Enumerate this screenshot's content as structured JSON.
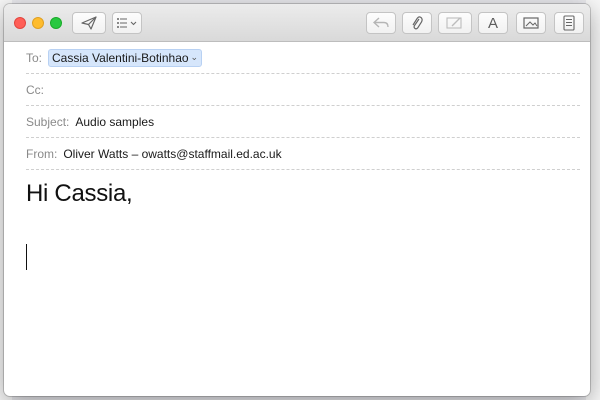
{
  "window": {
    "toolbar": {
      "send_icon": "paper-plane-icon",
      "header_fields_icon": "list-icon",
      "reply_icon": "reply-arrow-icon",
      "attach_icon": "paperclip-icon",
      "markup_icon": "markup-icon",
      "format_letter": "A",
      "photo_icon": "photo-browser-icon",
      "doc_icon": "document-icon"
    },
    "fields": {
      "to_label": "To:",
      "to_value": "Cassia Valentini-Botinhao",
      "cc_label": "Cc:",
      "cc_value": "",
      "subject_label": "Subject:",
      "subject_value": "Audio samples",
      "from_label": "From:",
      "from_value": "Oliver Watts – owatts@staffmail.ed.ac.uk"
    },
    "body": {
      "greeting": "Hi Cassia,"
    }
  },
  "colors": {
    "close": "#ff5f57",
    "minimize": "#febc2e",
    "maximize": "#28c840",
    "token_bg": "#d6e6fb"
  }
}
